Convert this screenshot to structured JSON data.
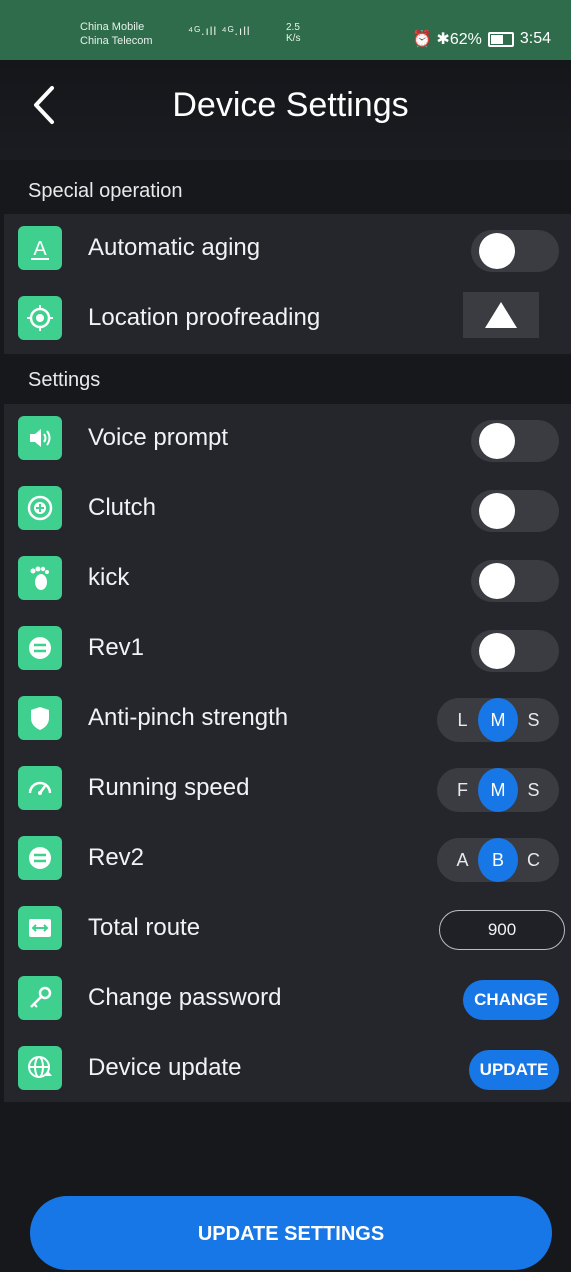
{
  "status_bar": {
    "carrier1": "China Mobile",
    "carrier2": "China Telecom",
    "signal": "⁴ᴳ.ıll ⁴ᴳ.ıll ",
    "speed_value": "2.5",
    "speed_unit": "K/s",
    "right": "⏰ ✱62%",
    "time": "3:54"
  },
  "header": {
    "title": "Device Settings"
  },
  "special": {
    "label": "Special operation",
    "items": [
      {
        "label": "Automatic aging"
      },
      {
        "label": "Location proofreading"
      }
    ]
  },
  "settings": {
    "label": "Settings",
    "items": [
      {
        "label": "Voice prompt"
      },
      {
        "label": "Clutch"
      },
      {
        "label": "kick"
      },
      {
        "label": "Rev1"
      },
      {
        "label": "Anti-pinch strength",
        "options": [
          "L",
          "M",
          "S"
        ],
        "selected": "M"
      },
      {
        "label": "Running speed",
        "options": [
          "F",
          "M",
          "S"
        ],
        "selected": "M"
      },
      {
        "label": "Rev2",
        "options": [
          "A",
          "B",
          "C"
        ],
        "selected": "B"
      },
      {
        "label": "Total route",
        "value": "900"
      },
      {
        "label": "Change password",
        "button": "CHANGE"
      },
      {
        "label": "Device update",
        "button": "UPDATE"
      }
    ]
  },
  "footer": {
    "button": "UPDATE SETTINGS"
  },
  "colors": {
    "accent": "#1877e6",
    "icon_bg": "#3fcf8e",
    "status_bar": "#2f6c4c"
  }
}
